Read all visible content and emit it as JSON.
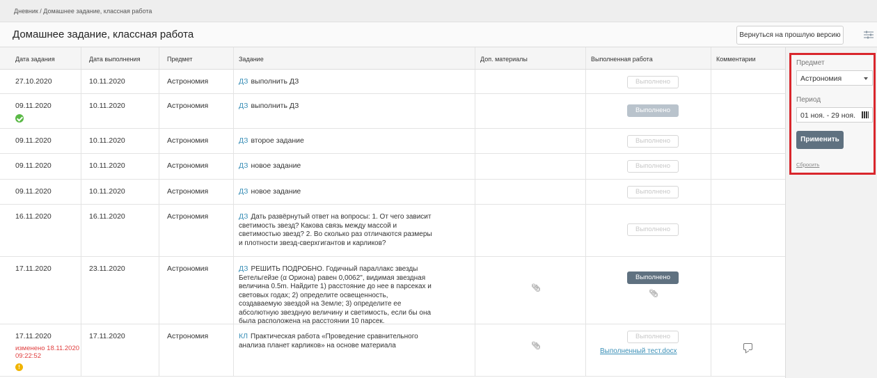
{
  "breadcrumb": "Дневник / Домашнее задание, классная работа",
  "title": "Домашнее задание, классная работа",
  "back_button": "Вернуться на прошлую версию",
  "columns": [
    "Дата задания",
    "Дата выполнения",
    "Предмет",
    "Задание",
    "Доп. материалы",
    "Выполненная работа",
    "Комментарии"
  ],
  "rows": [
    {
      "date": "27.10.2020",
      "due": "10.11.2020",
      "subject": "Астрономия",
      "tag": "ДЗ",
      "task": "выполнить ДЗ",
      "done_label": "Выполнено",
      "done_state": "outline"
    },
    {
      "date": "09.11.2020",
      "due": "10.11.2020",
      "subject": "Астрономия",
      "tag": "ДЗ",
      "task": "выполнить ДЗ",
      "done_label": "Выполнено",
      "done_state": "filled-light"
    },
    {
      "date": "09.11.2020",
      "due": "10.11.2020",
      "subject": "Астрономия",
      "tag": "ДЗ",
      "task": "второе задание",
      "done_label": "Выполнено",
      "done_state": "outline"
    },
    {
      "date": "09.11.2020",
      "due": "10.11.2020",
      "subject": "Астрономия",
      "tag": "ДЗ",
      "task": "новое задание",
      "done_label": "Выполнено",
      "done_state": "outline"
    },
    {
      "date": "09.11.2020",
      "due": "10.11.2020",
      "subject": "Астрономия",
      "tag": "ДЗ",
      "task": "новое задание",
      "done_label": "Выполнено",
      "done_state": "outline"
    },
    {
      "date": "16.11.2020",
      "due": "16.11.2020",
      "subject": "Астрономия",
      "tag": "ДЗ",
      "task": "Дать развёрнутый ответ на вопросы: 1. От чего зависит светимость звезд? Какова связь между массой и светимостью звезд? 2. Во сколько раз отличаются размеры и плотности звезд-сверхгигантов и карликов?",
      "done_label": "Выполнено",
      "done_state": "outline"
    },
    {
      "date": "17.11.2020",
      "due": "23.11.2020",
      "subject": "Астрономия",
      "tag": "ДЗ",
      "task": "РЕШИТЬ ПОДРОБНО. Годичный параллакс звезды Бетельгейзе (α Ориона) равен 0,0062\", видимая звездная величина 0.5m. Найдите 1) расстояние до нее в парсеках и световых годах; 2) определите освещенность, создаваемую звездой на Земле; 3) определите ее абсолютную звездную величину и светимость, если бы она была расположена на расстоянии 10 парсек.",
      "done_label": "Выполнено",
      "done_state": "filled-dark"
    },
    {
      "date": "17.11.2020",
      "changed": "изменено 18.11.2020 09:22:52",
      "due": "17.11.2020",
      "subject": "Астрономия",
      "tag": "КЛ",
      "task": "Практическая работа «Проведение сравнительного анализа планет карликов» на основе материала",
      "done_label": "Выполнено",
      "done_state": "outline",
      "file": "Выполненный тест.docx"
    }
  ],
  "filter": {
    "subject_label": "Предмет",
    "subject_value": "Астрономия",
    "period_label": "Период",
    "period_value": "01 ноя. - 29 ноя.",
    "apply": "Применить",
    "reset": "Сбросить"
  },
  "colors": {
    "accent": "#3a8fb7",
    "button_dark": "#5f7180",
    "highlight": "#d9262c",
    "changed": "#e04040"
  }
}
